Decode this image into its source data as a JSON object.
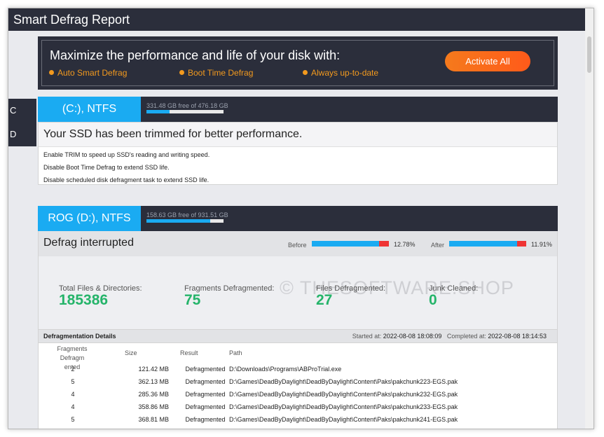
{
  "window": {
    "title": "Smart Defrag Report"
  },
  "promo": {
    "title": "Maximize the performance and life of your disk with:",
    "features": [
      "Auto Smart Defrag",
      "Boot Time Defrag",
      "Always up-to-date"
    ],
    "button": "Activate All"
  },
  "side_tabs": [
    "C",
    "D"
  ],
  "drives": [
    {
      "name": "(C:), NTFS",
      "space": "331.48 GB free of 476.18 GB",
      "used_fraction": 0.3,
      "message": "Your SSD has been trimmed for better performance.",
      "tips": [
        "Enable TRIM to speed up SSD's reading and writing speed.",
        "Disable Boot Time Defrag to extend SSD life.",
        "Disable scheduled disk defragment task to extend SSD life."
      ]
    },
    {
      "name": "ROG (D:), NTFS",
      "space": "158.63 GB free of 931.51 GB",
      "used_fraction": 0.83,
      "status": "Defrag interrupted",
      "before_label": "Before",
      "before_value": "12.78%",
      "before_fraction": 0.8722,
      "after_label": "After",
      "after_value": "11.91%",
      "after_fraction": 0.8809,
      "stats": [
        {
          "label": "Total Files & Directories:",
          "value": "185386"
        },
        {
          "label": "Fragments Defragmented:",
          "value": "75"
        },
        {
          "label": "Files Defragmented:",
          "value": "27"
        },
        {
          "label": "Junk Cleaned:",
          "value": "0"
        }
      ],
      "watermark": "© THESOFTWARE.SHOP",
      "details": {
        "title": "Defragmentation Details",
        "started_label": "Started at:",
        "started_value": "2022-08-08 18:08:09",
        "completed_label": "Completed at:",
        "completed_value": "2022-08-08 18:14:53",
        "columns": [
          "Fragments Defragm",
          "ented",
          "Size",
          "Result",
          "Path"
        ],
        "rows": [
          {
            "frag": "2",
            "size": "121.42 MB",
            "result": "Defragmented",
            "path": "D:\\Downloads\\Programs\\ABProTrial.exe"
          },
          {
            "frag": "5",
            "size": "362.13 MB",
            "result": "Defragmented",
            "path": "D:\\Games\\DeadByDaylight\\DeadByDaylight\\Content\\Paks\\pakchunk223-EGS.pak"
          },
          {
            "frag": "4",
            "size": "285.36 MB",
            "result": "Defragmented",
            "path": "D:\\Games\\DeadByDaylight\\DeadByDaylight\\Content\\Paks\\pakchunk232-EGS.pak"
          },
          {
            "frag": "4",
            "size": "358.86 MB",
            "result": "Defragmented",
            "path": "D:\\Games\\DeadByDaylight\\DeadByDaylight\\Content\\Paks\\pakchunk233-EGS.pak"
          },
          {
            "frag": "5",
            "size": "368.81 MB",
            "result": "Defragmented",
            "path": "D:\\Games\\DeadByDaylight\\DeadByDaylight\\Content\\Paks\\pakchunk241-EGS.pak"
          }
        ]
      }
    }
  ],
  "colors": {
    "dark": "#2b2e3b",
    "accent": "#1aabf2",
    "orange": "#f39a1e",
    "green": "#25b46a",
    "red": "#ef3434"
  }
}
